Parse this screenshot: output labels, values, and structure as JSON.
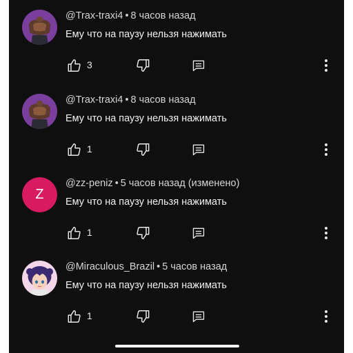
{
  "comments": [
    {
      "author": "@Trax-traxi4",
      "separator": "•",
      "time": "8 часов назад",
      "text": "Ему что на паузу нельзя нажимать",
      "likes": "3",
      "avatar_icon": "muscular-figure-avatar",
      "avatar_bg": "#7a3f9c"
    },
    {
      "author": "@Trax-traxi4",
      "separator": "•",
      "time": "8 часов назад",
      "text": "Ему что на паузу нельзя нажимать",
      "likes": "1",
      "avatar_icon": "muscular-figure-avatar",
      "avatar_bg": "#7a3f9c"
    },
    {
      "author": "@zz-peniz",
      "separator": "•",
      "time": "5 часов назад (изменено)",
      "text": "Ему что на паузу нельзя нажимать",
      "likes": "1",
      "avatar_letter": "Z",
      "avatar_bg": "#d81b60"
    },
    {
      "author": "@Miraculous_Brazil",
      "separator": "•",
      "time": "5 часов назад",
      "text": "Ему что на паузу нельзя нажимать",
      "likes": "1",
      "avatar_icon": "cartoon-girl-avatar",
      "avatar_bg": "#f3d6e8"
    }
  ],
  "icons": {
    "like": "thumb-up-icon",
    "dislike": "thumb-down-icon",
    "reply": "reply-comment-icon",
    "more": "more-vertical-icon"
  },
  "colors": {
    "background": "#0f0f0f",
    "text": "#f1f1f1",
    "meta": "#d6d6d6"
  }
}
